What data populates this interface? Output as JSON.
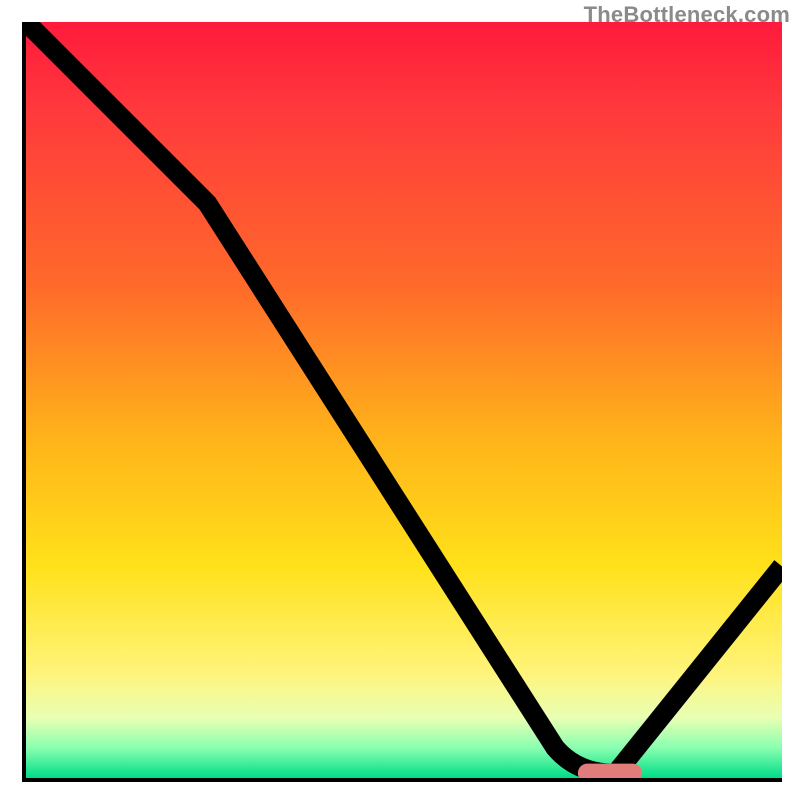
{
  "watermark": "TheBottleneck.com",
  "colors": {
    "axis": "#000000",
    "marker": "#e07d7a",
    "gradient_top": "#ff1a3c",
    "gradient_bottom": "#00dd88"
  },
  "chart_data": {
    "type": "line",
    "title": "",
    "xlabel": "",
    "ylabel": "",
    "xlim": [
      0,
      100
    ],
    "ylim": [
      0,
      100
    ],
    "series": [
      {
        "name": "curve",
        "x": [
          0,
          24,
          70,
          75,
          78,
          100
        ],
        "y": [
          100,
          76,
          4,
          0.6,
          0.6,
          28
        ]
      }
    ],
    "annotations": [
      {
        "name": "min-marker",
        "x": 77,
        "y": 0.6,
        "shape": "pill",
        "color": "#e07d7a"
      }
    ],
    "grid": false,
    "legend": null,
    "notes": "y-values are a 0–100 percentage scale (0 = x-axis / green zone, 100 = top / red zone). x is a 0–100 normalized horizontal position. Values estimated from pixel geometry; the chart has no tick labels in the source image."
  }
}
